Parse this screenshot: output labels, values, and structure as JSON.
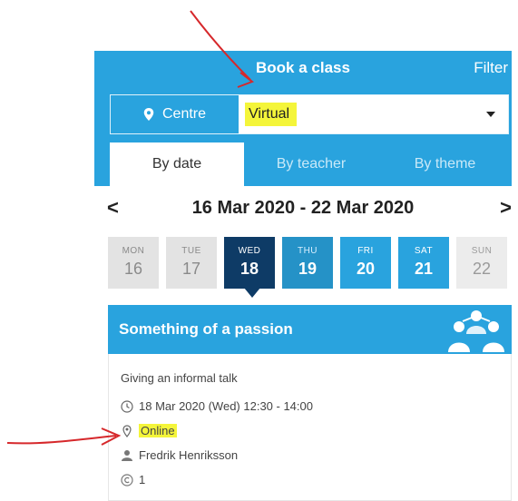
{
  "header": {
    "title": "Book a class",
    "filter_label": "Filter"
  },
  "location": {
    "centre_label": "Centre",
    "selected": "Virtual"
  },
  "tabs": [
    {
      "label": "By date",
      "active": true
    },
    {
      "label": "By teacher",
      "active": false
    },
    {
      "label": "By theme",
      "active": false
    }
  ],
  "week": {
    "prev": "<",
    "next": ">",
    "range": "16 Mar 2020 - 22 Mar 2020"
  },
  "days": [
    {
      "name": "MON",
      "date": "16"
    },
    {
      "name": "TUE",
      "date": "17"
    },
    {
      "name": "WED",
      "date": "18",
      "selected": true
    },
    {
      "name": "THU",
      "date": "19"
    },
    {
      "name": "FRI",
      "date": "20"
    },
    {
      "name": "SAT",
      "date": "21"
    },
    {
      "name": "SUN",
      "date": "22"
    }
  ],
  "event": {
    "theme": "Something of a passion",
    "title": "Giving an informal talk",
    "datetime": "18 Mar 2020 (Wed) 12:30 - 14:00",
    "location": "Online",
    "teacher": "Fredrik Henriksson",
    "count": "1"
  },
  "colors": {
    "brand_blue": "#29a3de",
    "selected_day": "#0e3b66",
    "highlight": "#f4f53a",
    "annotation": "#d6282b"
  }
}
